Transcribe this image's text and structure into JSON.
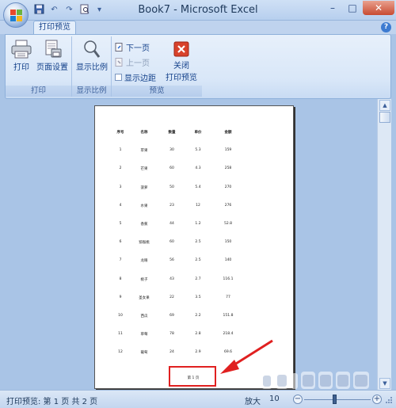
{
  "window": {
    "title": "Book7 - Microsoft Excel",
    "controls": {
      "minimize": "–",
      "maximize": "□",
      "close": "✕"
    }
  },
  "quick_access": [
    "save-icon",
    "undo-icon",
    "redo-icon",
    "print-preview-icon",
    "customize-icon"
  ],
  "tabs": [
    {
      "label": "打印预览",
      "active": true
    }
  ],
  "help_label": "?",
  "ribbon": {
    "groups": [
      {
        "label": "打印",
        "buttons": [
          {
            "label": "打印",
            "icon": "printer-icon"
          },
          {
            "label": "页面设置",
            "icon": "page-setup-icon"
          }
        ]
      },
      {
        "label": "显示比例",
        "buttons": [
          {
            "label": "显示比例",
            "icon": "magnifier-icon"
          }
        ]
      },
      {
        "label": "预览",
        "small_buttons": [
          {
            "label": "下一页",
            "icon": "next-page-icon",
            "enabled": true
          },
          {
            "label": "上一页",
            "icon": "prev-page-icon",
            "enabled": false
          },
          {
            "label": "显示边距",
            "icon": "checkbox",
            "checked": false
          }
        ],
        "buttons": [
          {
            "label": "关闭\n打印预览",
            "label_line1": "关闭",
            "label_line2": "打印预览",
            "icon": "close-preview-icon"
          }
        ]
      }
    ]
  },
  "sheet": {
    "headers": [
      "序号",
      "名称",
      "数量",
      "单价",
      "金额"
    ],
    "rows": [
      [
        "1",
        "苹果",
        "30",
        "5.3",
        "159"
      ],
      [
        "2",
        "芒果",
        "60",
        "4.3",
        "258"
      ],
      [
        "3",
        "菠萝",
        "50",
        "5.4",
        "270"
      ],
      [
        "4",
        "水果",
        "23",
        "12",
        "276"
      ],
      [
        "5",
        "香蕉",
        "44",
        "1.2",
        "52.8"
      ],
      [
        "6",
        "猕猴桃",
        "60",
        "2.5",
        "150"
      ],
      [
        "7",
        "龙眼",
        "56",
        "2.5",
        "140"
      ],
      [
        "8",
        "桃子",
        "43",
        "2.7",
        "116.1"
      ],
      [
        "9",
        "圣女果",
        "22",
        "3.5",
        "77"
      ],
      [
        "10",
        "西瓜",
        "69",
        "2.2",
        "151.8"
      ],
      [
        "11",
        "草莓",
        "78",
        "2.8",
        "218.4"
      ],
      [
        "12",
        "葡萄",
        "24",
        "2.9",
        "69.6"
      ]
    ],
    "footer": "第 1 页"
  },
  "status": {
    "text": "打印预览: 第 1 页  共 2 页",
    "zoom_label": "放大",
    "zoom_percent": "10",
    "zoom_minus": "−",
    "zoom_plus": "+"
  },
  "colors": {
    "highlight": "#e02020",
    "accent": "#15428b"
  }
}
